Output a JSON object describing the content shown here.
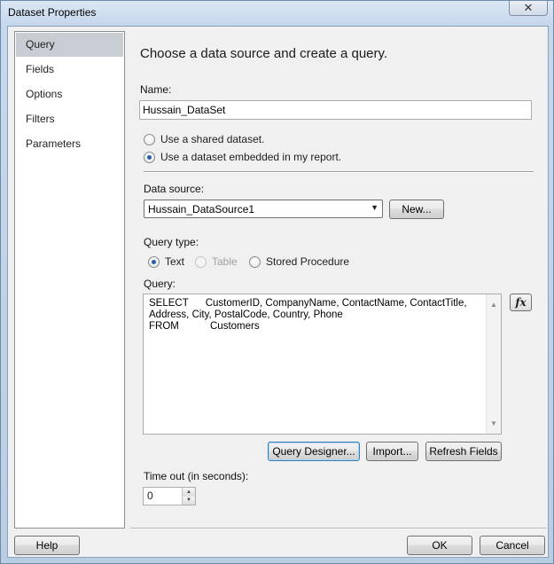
{
  "window": {
    "title": "Dataset Properties",
    "close_glyph": "✕"
  },
  "sidebar": {
    "items": [
      {
        "label": "Query",
        "selected": true
      },
      {
        "label": "Fields"
      },
      {
        "label": "Options"
      },
      {
        "label": "Filters"
      },
      {
        "label": "Parameters"
      }
    ]
  },
  "main": {
    "heading": "Choose a data source and create a query.",
    "name_label": "Name:",
    "name_value": "Hussain_DataSet",
    "shared_dataset_label": "Use a shared dataset.",
    "embedded_dataset_label": "Use a dataset embedded in my report.",
    "data_source_label": "Data source:",
    "data_source_value": "Hussain_DataSource1",
    "new_button": "New...",
    "query_type_label": "Query type:",
    "query_type_options": [
      "Text",
      "Table",
      "Stored Procedure"
    ],
    "query_label": "Query:",
    "query_lines": [
      "SELECT      CustomerID, CompanyName, ContactName, ContactTitle,",
      "Address, City, PostalCode, Country, Phone",
      "FROM           Customers"
    ],
    "fx_label": "fx",
    "query_designer_button": "Query Designer...",
    "import_button": "Import...",
    "refresh_fields_button": "Refresh Fields",
    "timeout_label": "Time out (in seconds):",
    "timeout_value": "0"
  },
  "footer": {
    "help_button": "Help",
    "ok_button": "OK",
    "cancel_button": "Cancel"
  }
}
